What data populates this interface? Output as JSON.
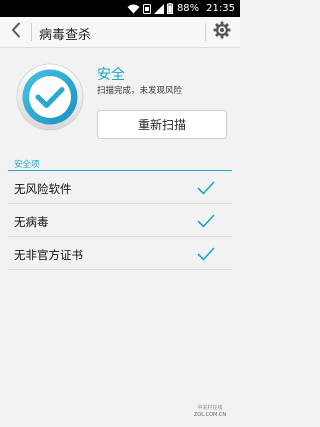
{
  "status_bar": {
    "battery_percent": "88%",
    "time": "21:35"
  },
  "title_bar": {
    "title": "病毒查杀"
  },
  "scan_result": {
    "status_title": "安全",
    "status_desc": "扫描完成，未发现风险",
    "rescan_label": "重新扫描"
  },
  "safety_section": {
    "header": "安全项",
    "items": [
      {
        "label": "无风险软件"
      },
      {
        "label": "无病毒"
      },
      {
        "label": "无非官方证书"
      }
    ]
  },
  "watermark": {
    "line1": "中关村在线",
    "line2": "ZOL.COM.CN"
  },
  "colors": {
    "accent": "#1fa7c9",
    "shield_fill": "#2aa8cf"
  },
  "icons": [
    "wifi-icon",
    "sim-icon",
    "signal-icon",
    "battery-icon",
    "back-chevron-icon",
    "gear-icon",
    "shield-check-icon",
    "checkmark-icon"
  ]
}
